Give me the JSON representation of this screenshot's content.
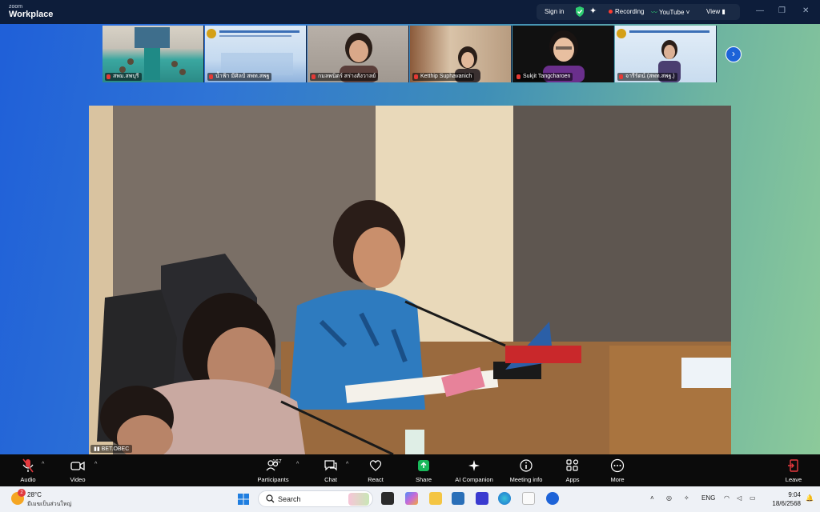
{
  "titlebar": {
    "brand_small": "zoom",
    "brand_big": "Workplace",
    "signin": "Sign in",
    "recording": "Recording",
    "youtube": "YouTube",
    "view": "View"
  },
  "thumbnails": [
    {
      "name": "สพม.สพบุรี"
    },
    {
      "name": "น้ำฟ้า มีศิลป์ สพท.สพฐ"
    },
    {
      "name": "กมลพนิตร์ สร่างสังวาลย์"
    },
    {
      "name": "Ketthip Suphavanich"
    },
    {
      "name": "Sukjit Tangcharoen"
    },
    {
      "name": "จารีรัตน์ (สพท.สพฐ.)"
    }
  ],
  "main_video": {
    "label": "BET.OBEC"
  },
  "toolbar": {
    "audio": "Audio",
    "video": "Video",
    "participants": "Participants",
    "participants_count": "167",
    "chat": "Chat",
    "react": "React",
    "share": "Share",
    "ai_companion": "AI Companion",
    "meeting_info": "Meeting info",
    "apps": "Apps",
    "more": "More",
    "leave": "Leave"
  },
  "taskbar": {
    "weather_temp": "28°C",
    "weather_desc": "มีเมฆเป็นส่วนใหญ่",
    "weather_badge": "2",
    "search_placeholder": "Search",
    "lang": "ENG",
    "time": "9:04",
    "date": "18/6/2568"
  },
  "colors": {
    "accent": "#1d63d8",
    "titlebar_bg": "#0d1d3a",
    "record_dot": "#ff3b30",
    "share_green": "#19b85a",
    "leave_red": "#e5393e"
  }
}
